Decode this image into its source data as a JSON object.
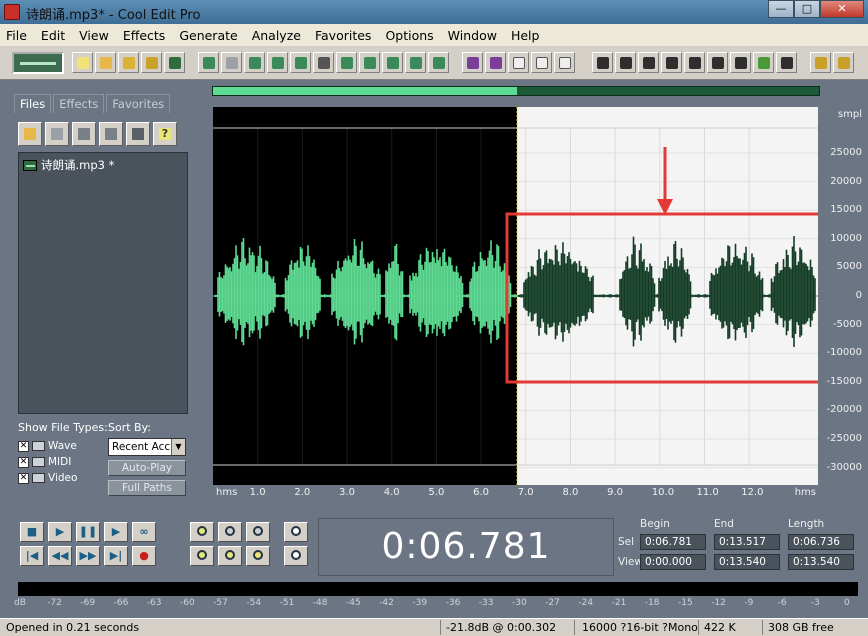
{
  "window": {
    "title": "诗朗诵.mp3* - Cool Edit Pro"
  },
  "menu": [
    "File",
    "Edit",
    "View",
    "Effects",
    "Generate",
    "Analyze",
    "Favorites",
    "Options",
    "Window",
    "Help"
  ],
  "left_panel": {
    "tabs": [
      "Files",
      "Effects",
      "Favorites"
    ],
    "active_tab": "Files",
    "files": [
      "诗朗诵.mp3 *"
    ],
    "show_file_types_label": "Show File Types:",
    "sort_by_label": "Sort By:",
    "types": [
      "Wave",
      "MIDI",
      "Video"
    ],
    "sort_value": "Recent Acc",
    "auto_play": "Auto-Play",
    "full_paths": "Full Paths"
  },
  "waveform": {
    "x_unit": "hms",
    "x_ticks": [
      "1.0",
      "2.0",
      "3.0",
      "4.0",
      "5.0",
      "6.0",
      "7.0",
      "8.0",
      "9.0",
      "10.0",
      "11.0",
      "12.0"
    ],
    "y_unit": "smpl",
    "y_ticks": [
      "25000",
      "20000",
      "15000",
      "10000",
      "5000",
      "0",
      "-5000",
      "-10000",
      "-15000",
      "-20000",
      "-25000",
      "-30000"
    ],
    "selection_start_seconds": 6.781,
    "total_seconds": 13.54,
    "colors": {
      "unselected_bg": "#000000",
      "unselected_wave": "#5fdc94",
      "selected_bg": "#f4f4f4",
      "selected_wave": "#123c26",
      "annotation": "#e53935"
    }
  },
  "transport": {
    "time": "0:06.781",
    "headers": [
      "Begin",
      "End",
      "Length"
    ],
    "sel_label": "Sel",
    "view_label": "View",
    "sel": [
      "0:06.781",
      "0:13.517",
      "0:06.736"
    ],
    "view": [
      "0:00.000",
      "0:13.540",
      "0:13.540"
    ]
  },
  "meter": {
    "ticks": [
      "dB",
      "-72",
      "-69",
      "-66",
      "-63",
      "-60",
      "-57",
      "-54",
      "-51",
      "-48",
      "-45",
      "-42",
      "-39",
      "-36",
      "-33",
      "-30",
      "-27",
      "-24",
      "-21",
      "-18",
      "-15",
      "-12",
      "-9",
      "-6",
      "-3",
      "0"
    ]
  },
  "status": {
    "message": "Opened in 0.21 seconds",
    "level": "-21.8dB @  0:00.302",
    "format": "16000 ?16-bit ?Mono",
    "size": "422 K",
    "free": "308 GB free"
  }
}
